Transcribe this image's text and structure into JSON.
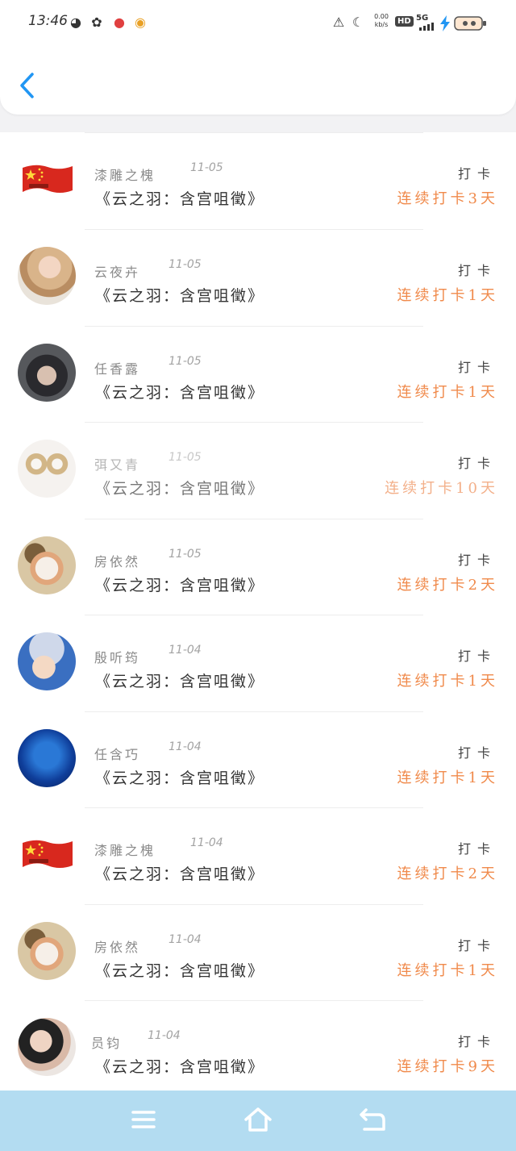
{
  "status_bar": {
    "time": "13:46",
    "net_speed": "0.00",
    "net_unit": "kb/s",
    "hd": "HD",
    "network": "5G"
  },
  "header": {
    "back_icon": "chevron-left-icon"
  },
  "items": [
    {
      "name": "漆雕之槐",
      "date": "11-05",
      "title": "《云之羽：含宫咀徵》",
      "action": "打卡",
      "streak": "连续打卡3天",
      "avatar": "china-flag"
    },
    {
      "name": "云夜卉",
      "date": "11-05",
      "title": "《云之羽：含宫咀徵》",
      "action": "打卡",
      "streak": "连续打卡1天",
      "avatar": "woman-photo"
    },
    {
      "name": "任香露",
      "date": "11-05",
      "title": "《云之羽：含宫咀徵》",
      "action": "打卡",
      "streak": "连续打卡1天",
      "avatar": "man-photo"
    },
    {
      "name": "弭又青",
      "date": "11-05",
      "title": "《云之羽：含宫咀徵》",
      "action": "打卡",
      "streak": "连续打卡10天",
      "avatar": "pearl-earrings"
    },
    {
      "name": "房依然",
      "date": "11-05",
      "title": "《云之羽：含宫咀徵》",
      "action": "打卡",
      "streak": "连续打卡2天",
      "avatar": "cat-photo"
    },
    {
      "name": "殷听筠",
      "date": "11-04",
      "title": "《云之羽：含宫咀徵》",
      "action": "打卡",
      "streak": "连续打卡1天",
      "avatar": "anime-character"
    },
    {
      "name": "任含巧",
      "date": "11-04",
      "title": "《云之羽：含宫咀徵》",
      "action": "打卡",
      "streak": "连续打卡1天",
      "avatar": "aquarium-photo"
    },
    {
      "name": "漆雕之槐",
      "date": "11-04",
      "title": "《云之羽：含宫咀徵》",
      "action": "打卡",
      "streak": "连续打卡2天",
      "avatar": "china-flag"
    },
    {
      "name": "房依然",
      "date": "11-04",
      "title": "《云之羽：含宫咀徵》",
      "action": "打卡",
      "streak": "连续打卡1天",
      "avatar": "cat-photo"
    },
    {
      "name": "员钧",
      "date": "11-04",
      "title": "《云之羽：含宫咀徵》",
      "action": "打卡",
      "streak": "连续打卡9天",
      "avatar": "woman-portrait"
    }
  ],
  "nav_bar": {
    "menu_icon": "menu-icon",
    "home_icon": "home-icon",
    "back_icon": "back-arrow-icon"
  },
  "colors": {
    "accent": "#2196F3",
    "streak": "#F08A4B",
    "nav_bg": "#B3DCF1"
  }
}
